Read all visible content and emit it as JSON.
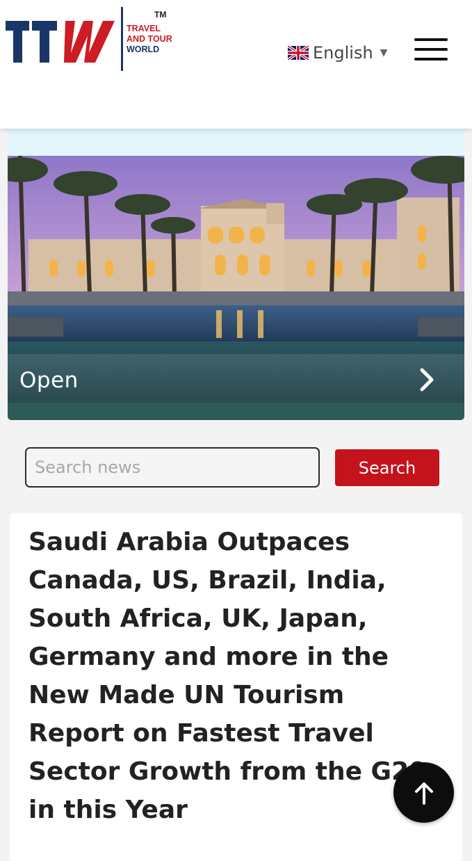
{
  "header": {
    "logo": {
      "mark_text": "TTW",
      "tm": "TM",
      "text_lines": [
        "TRAVEL",
        "AND TOUR",
        "WORLD"
      ]
    },
    "language": {
      "flag_icon": "uk-flag-icon",
      "label": "English",
      "caret_icon": "caret-down-icon"
    },
    "menu_icon": "hamburger-menu-icon"
  },
  "hero": {
    "open_label": "Open",
    "chevron_icon": "chevron-right-icon"
  },
  "search": {
    "placeholder": "Search news",
    "value": "",
    "button_label": "Search"
  },
  "article": {
    "headline": "Saudi Arabia Outpaces Canada, US, Brazil, India, South Africa, UK, Japan, Germany and more in the New Made UN Tourism Report on Fastest Travel Sector Growth from the G20 in this Year"
  },
  "back_to_top": {
    "icon": "arrow-up-icon"
  },
  "colors": {
    "brand_red": "#c4131a",
    "brand_navy": "#1a3568",
    "strip": "#e3f6fc",
    "hero_overlay": "#1f4a50"
  }
}
